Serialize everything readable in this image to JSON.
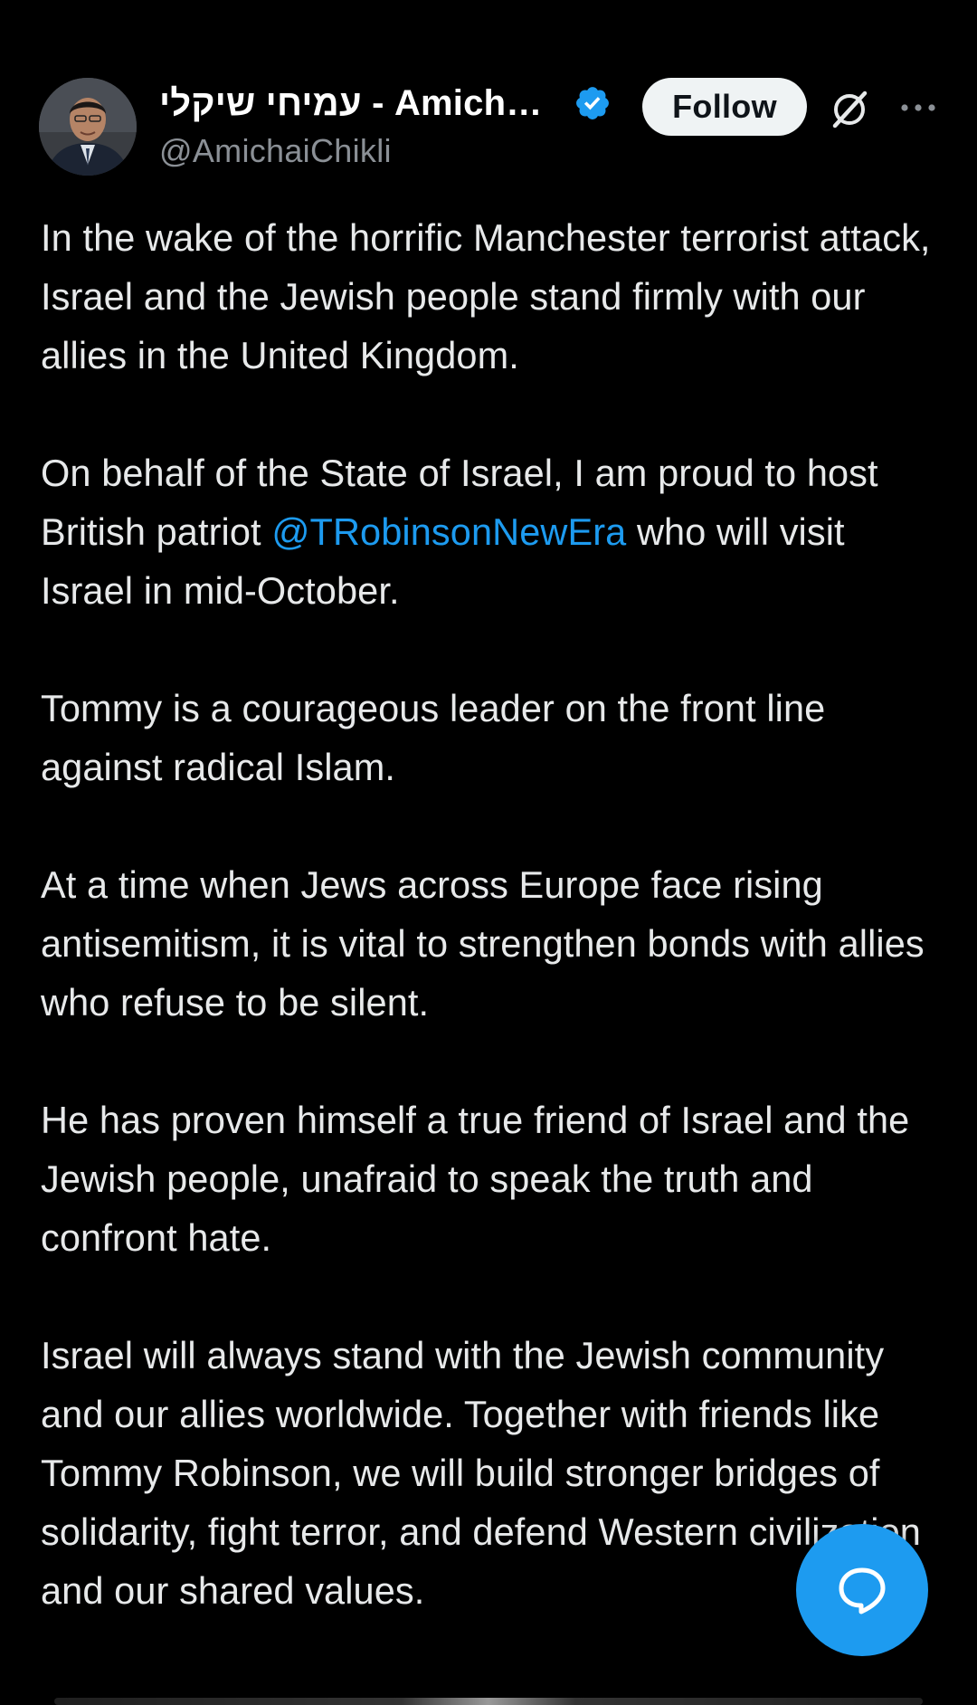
{
  "author": {
    "display_name": "עמיחי שיקלי - Amichai ...",
    "handle": "@AmichaiChikli",
    "verified": true,
    "avatar_icon": "profile-photo"
  },
  "actions": {
    "follow_label": "Follow",
    "grok_icon": "grok-icon",
    "more_icon": "more-icon"
  },
  "tweet": {
    "paragraphs": [
      {
        "text": "In the wake of the horrific Manchester terrorist attack, Israel and the Jewish people stand firmly with our allies in the United Kingdom."
      },
      {
        "before": "On behalf of the State of Israel, I am proud to host British patriot ",
        "mention": "@TRobinsonNewEra",
        "after": " who will visit Israel in mid-October."
      },
      {
        "text": "Tommy is a courageous leader on the front line against radical Islam."
      },
      {
        "text": "At a time when Jews across Europe face rising antisemitism, it is vital to strengthen bonds with allies who refuse to be silent."
      },
      {
        "text": "He has proven himself a true friend of Israel and the Jewish people, unafraid to speak the truth and confront hate."
      },
      {
        "text": "Israel will always stand with the Jewish community and our allies worldwide. Together with friends like Tommy Robinson, we will build stronger bridges of solidarity, fight terror, and defend Western civilization and our shared values."
      }
    ]
  },
  "fab": {
    "icon": "reply-bubble-icon"
  },
  "colors": {
    "background": "#000000",
    "text": "#e7e9ea",
    "secondary_text": "#8b9096",
    "accent": "#1d9bf0",
    "follow_bg": "#eff3f4"
  }
}
